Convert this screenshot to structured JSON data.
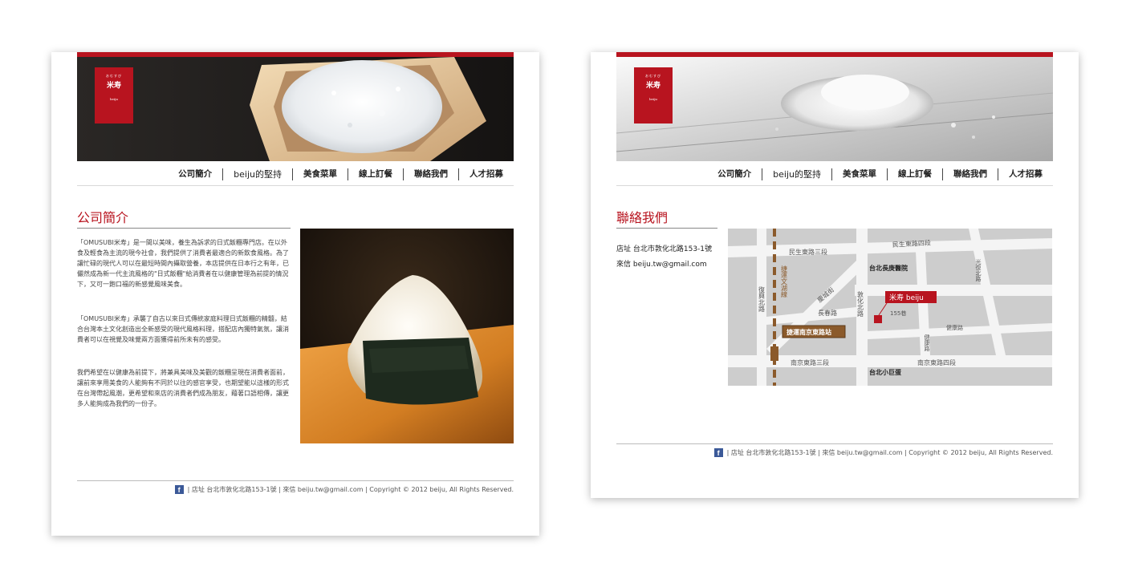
{
  "logo": {
    "small": "おむすび",
    "name": "米寿",
    "sub": "beiju"
  },
  "nav": [
    "公司簡介",
    "beiju的堅持",
    "美食菜單",
    "線上訂餐",
    "聯絡我們",
    "人才招募"
  ],
  "about": {
    "title": "公司簡介",
    "paragraphs": [
      "「OMUSUBI米寿」是一間以美味，養生為訴求的日式飯糰專門店。在以外食及輕食為主流的現今社會，我們提供了消費者最適合的新飲食風格。為了讓忙碌的現代人可以在最短時間內攝取營養，本店提供在日本行之有年，已儼然成為新一代主流風格的\"日式飯糰\"給消費者在以健康管理為前提的情況下，又可一飽口福的新感覺風味美食。",
      "「OMUSUBI米寿」承襲了自古以來日式傳統家庭料理日式飯糰的精髓，結合台灣本土文化創造出全新感受的現代風格料理，搭配店內獨特氣氛，讓消費者可以在視覺及味覺兩方面獲得前所未有的感受。",
      "我們希望在以健康為前提下，將兼具美味及美觀的飯糰呈現在消費者面前，讓前來享用美食的人能夠有不同於以往的感官享受，也期望能以這樣的形式在台灣帶起風潮，更希望和來店的消費者們成為朋友，藉著口語相傳，讓更多人能夠成為我們的一份子。"
    ]
  },
  "contact": {
    "title": "聯絡我們",
    "address": "店址 台北市敦化北路153-1號",
    "email": "來信 beiju.tw@gmail.com"
  },
  "map": {
    "roads": {
      "minsheng3": "民生東路三段",
      "minsheng4": "民生東路四段",
      "changchun": "長春路",
      "nanjing3": "南京東路三段",
      "nanjing4": "南京東路四段",
      "fuxing": "復興北路",
      "dunhua": "敦化北路",
      "guangfu": "光復北路",
      "jiankang1": "健康路",
      "jiankang2": "健康路",
      "qingcheng": "慶城街",
      "mrt_line": "捷運文湖線"
    },
    "places": {
      "hospital": "台北長庚醫院",
      "arena": "台北小巨蛋",
      "mrt_station": "捷運南京東路站",
      "store": "米寿 beiju",
      "number": "155巷"
    }
  },
  "footer": {
    "icon": "f",
    "text": "| 店址 台北市敦化北路153-1號 | 來信  beiju.tw@gmail.com | Copyright © 2012 beiju, All Rights Reserved."
  }
}
